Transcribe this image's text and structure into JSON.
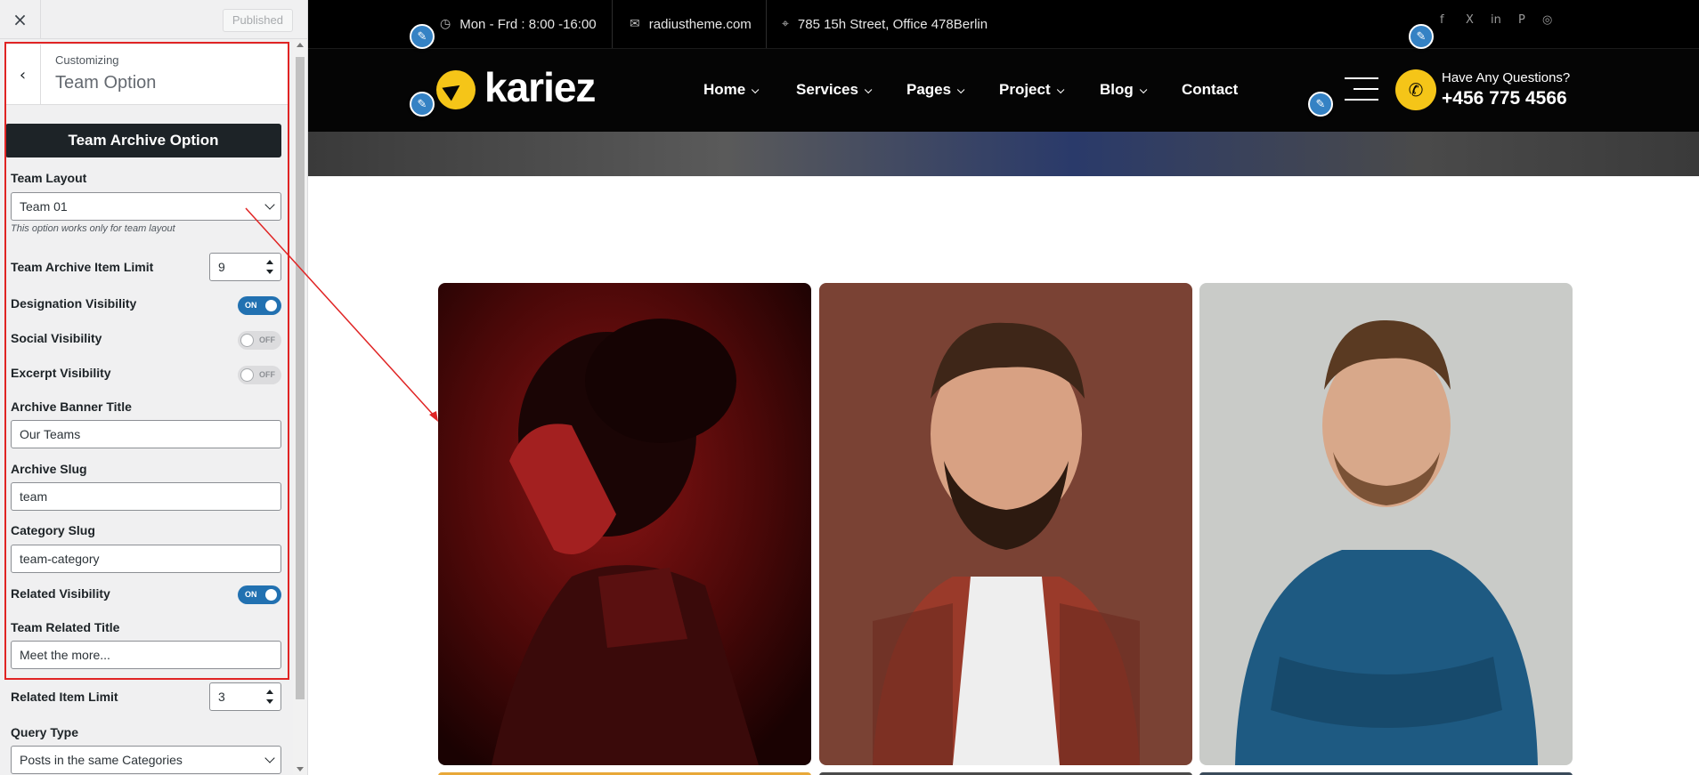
{
  "customizer": {
    "close_icon": "×",
    "publish_label": "Published",
    "back_icon": "‹",
    "section_small": "Customizing",
    "section_title": "Team Option",
    "heading_button": "Team Archive Option",
    "team_layout": {
      "label": "Team Layout",
      "value": "Team 01",
      "hint": "This option works only for team layout"
    },
    "archive_item_limit": {
      "label": "Team Archive Item Limit",
      "value": "9"
    },
    "designation_visibility": {
      "label": "Designation Visibility",
      "state": "ON"
    },
    "social_visibility": {
      "label": "Social Visibility",
      "state": "OFF"
    },
    "excerpt_visibility": {
      "label": "Excerpt Visibility",
      "state": "OFF"
    },
    "archive_banner_title": {
      "label": "Archive Banner Title",
      "value": "Our Teams"
    },
    "archive_slug": {
      "label": "Archive Slug",
      "value": "team"
    },
    "category_slug": {
      "label": "Category Slug",
      "value": "team-category"
    },
    "related_visibility": {
      "label": "Related Visibility",
      "state": "ON"
    },
    "team_related_title": {
      "label": "Team Related Title",
      "value": "Meet the more..."
    },
    "related_item_limit": {
      "label": "Related Item Limit",
      "value": "3"
    },
    "query_type": {
      "label": "Query Type",
      "value": "Posts in the same Categories"
    }
  },
  "site": {
    "topbar": {
      "hours": "Mon - Frd : 8:00 -16:00",
      "email": "radiustheme.com",
      "address": "785 15h Street, Office 478Berlin",
      "social": [
        "f",
        "X",
        "in",
        "P",
        "◎"
      ]
    },
    "logo_text": "kariez",
    "nav": [
      {
        "label": "Home",
        "dropdown": true
      },
      {
        "label": "Services",
        "dropdown": true
      },
      {
        "label": "Pages",
        "dropdown": true
      },
      {
        "label": "Project",
        "dropdown": true
      },
      {
        "label": "Blog",
        "dropdown": true
      },
      {
        "label": "Contact",
        "dropdown": false
      }
    ],
    "phone_question": "Have Any Questions?",
    "phone_number": "+456 775 4566",
    "team_members": [
      {
        "photo": "man in red sweater, profile, red lit"
      },
      {
        "photo": "bearded man in plaid shirt, brown backdrop"
      },
      {
        "photo": "man in blue shirt, arms crossed, grey backdrop"
      }
    ]
  },
  "colors": {
    "accent": "#f5c518",
    "wp_blue": "#2271b1",
    "frame_red": "#e02424"
  }
}
